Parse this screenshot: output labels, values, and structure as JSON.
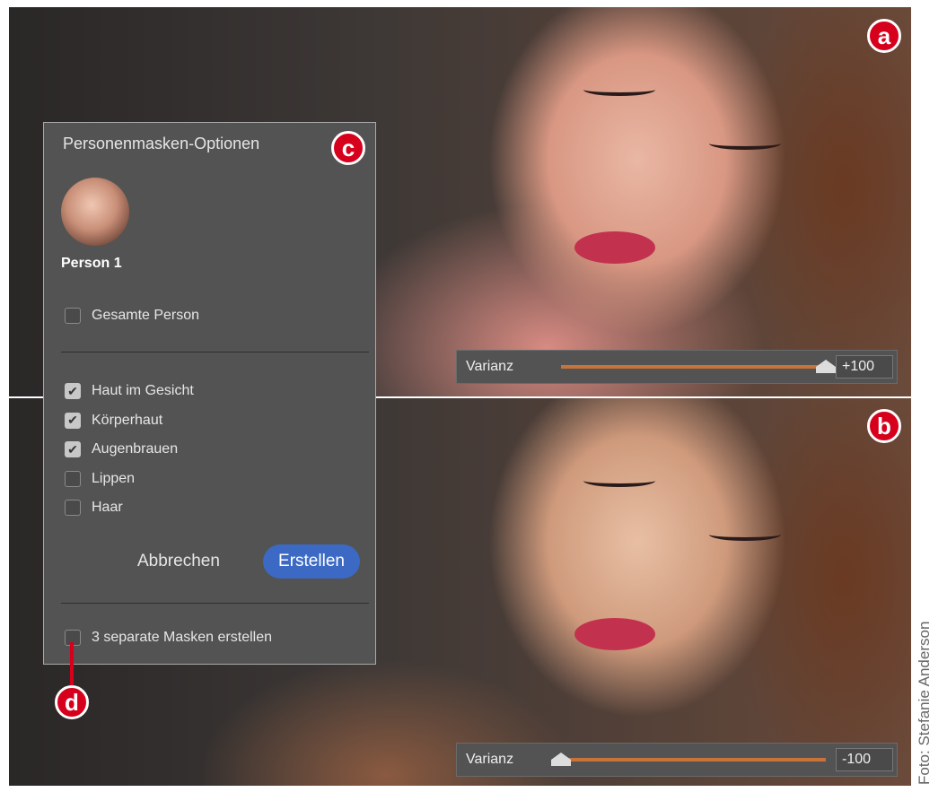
{
  "dialog": {
    "title": "Personenmasken-Optionen",
    "person_name": "Person 1",
    "whole_person": {
      "label": "Gesamte Person",
      "checked": false
    },
    "parts": [
      {
        "label": "Haut im Gesicht",
        "checked": true
      },
      {
        "label": "Körperhaut",
        "checked": true
      },
      {
        "label": "Augenbrauen",
        "checked": true
      },
      {
        "label": "Lippen",
        "checked": false
      },
      {
        "label": "Haar",
        "checked": false
      }
    ],
    "cancel_label": "Abbrechen",
    "create_label": "Erstellen",
    "separate_masks": {
      "label": "3 separate Masken erstellen",
      "checked": false
    }
  },
  "sliders": [
    {
      "label": "Varianz",
      "value": "+100",
      "fraction": 1.0
    },
    {
      "label": "Varianz",
      "value": "-100",
      "fraction": 0.0
    }
  ],
  "badges": {
    "a": "a",
    "b": "b",
    "c": "c",
    "d": "d"
  },
  "credit": "Foto: Stefanie Anderson",
  "colors": {
    "accent": "#3b69c3",
    "badge": "#d6001c",
    "slider_track": "#c8733a"
  }
}
